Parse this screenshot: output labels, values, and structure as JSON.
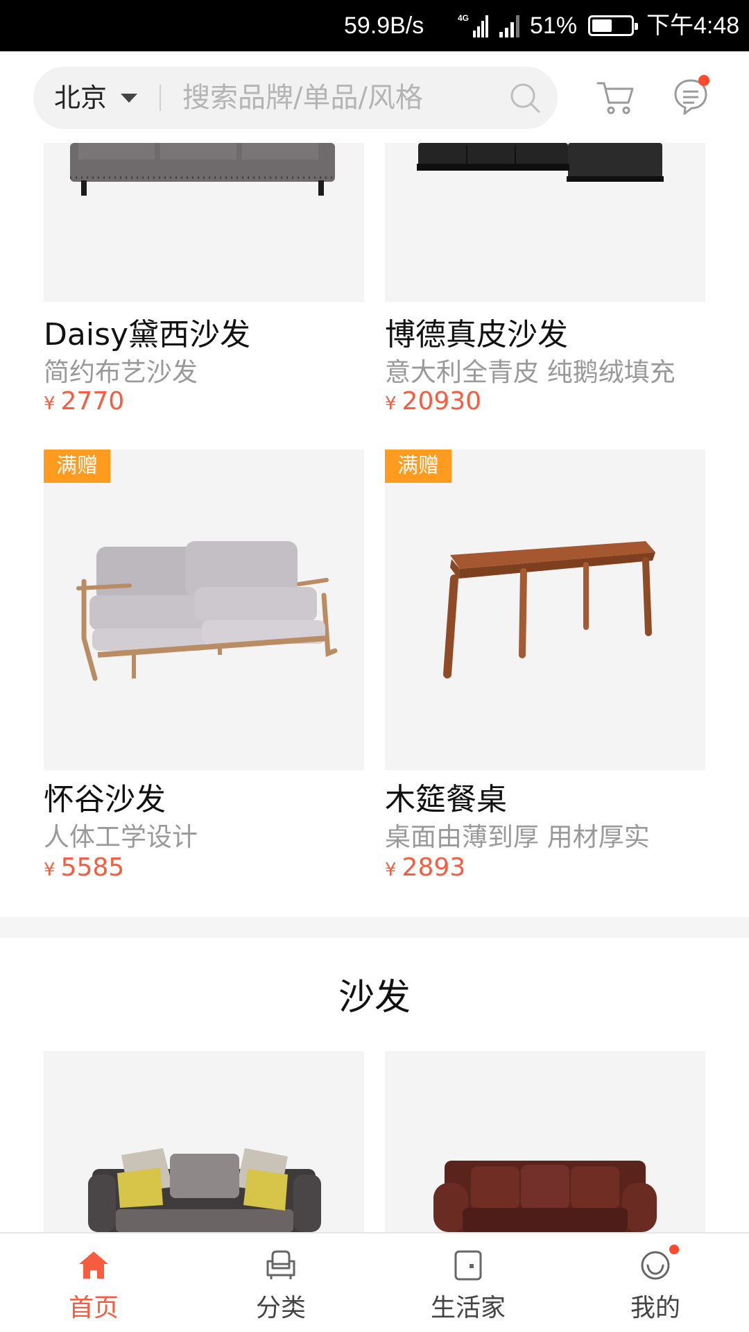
{
  "status_bar": {
    "speed": "59.9B/s",
    "network": "4G",
    "battery_percent": "51%",
    "battery_level": 0.51,
    "time": "下午4:48"
  },
  "header": {
    "city": "北京",
    "search_placeholder": "搜索品牌/单品/风格",
    "icons": [
      "search-icon",
      "cart-icon",
      "message-icon"
    ],
    "has_message_badge": true
  },
  "products_top": [
    {
      "name": "Daisy黛西沙发",
      "desc": "简约布艺沙发",
      "currency": "¥",
      "price": "2770",
      "tag": ""
    },
    {
      "name": "博德真皮沙发",
      "desc": "意大利全青皮 纯鹅绒填充",
      "currency": "¥",
      "price": "20930",
      "tag": ""
    }
  ],
  "products_mid": [
    {
      "name": "怀谷沙发",
      "desc": "人体工学设计",
      "currency": "¥",
      "price": "5585",
      "tag": "满赠"
    },
    {
      "name": "木筵餐桌",
      "desc": "桌面由薄到厚 用材厚实",
      "currency": "¥",
      "price": "2893",
      "tag": "满赠"
    }
  ],
  "section": {
    "title": "沙发"
  },
  "tabbar": [
    {
      "label": "首页",
      "icon": "home-icon",
      "active": true
    },
    {
      "label": "分类",
      "icon": "category-icon",
      "active": false
    },
    {
      "label": "生活家",
      "icon": "life-icon",
      "active": false
    },
    {
      "label": "我的",
      "icon": "profile-icon",
      "active": false,
      "badge": true
    }
  ],
  "colors": {
    "accent": "#f65c3d",
    "tag_bg": "#ff9c1f",
    "badge": "#ff4b2b",
    "image_bg": "#f4f4f4"
  }
}
